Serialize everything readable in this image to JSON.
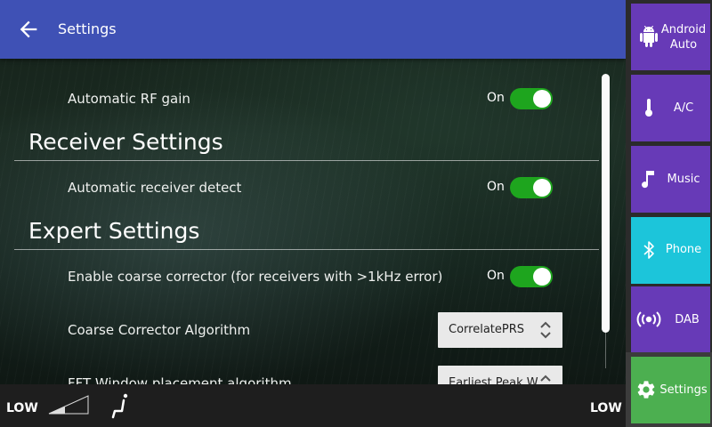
{
  "header": {
    "title": "Settings"
  },
  "settings": {
    "auto_rf_gain": {
      "label": "Automatic RF gain",
      "state": "On"
    },
    "receiver_section": "Receiver Settings",
    "auto_receiver_detect": {
      "label": "Automatic receiver detect",
      "state": "On"
    },
    "expert_section": "Expert Settings",
    "coarse_corrector": {
      "label": "Enable coarse corrector (for receivers with >1kHz error)",
      "state": "On"
    },
    "coarse_algorithm": {
      "label": "Coarse Corrector Algorithm",
      "value": "CorrelatePRS"
    },
    "fft_window": {
      "label": "FFT Window placement algorithm",
      "value": "Earliest Peak W"
    }
  },
  "bottom_bar": {
    "left_level": "LOW",
    "right_level": "LOW"
  },
  "sidebar": {
    "items": [
      {
        "label": "Android Auto",
        "icon": "android-icon",
        "color": "#673ab7"
      },
      {
        "label": "A/C",
        "icon": "thermometer-icon",
        "color": "#673ab7"
      },
      {
        "label": "Music",
        "icon": "music-note-icon",
        "color": "#673ab7"
      },
      {
        "label": "Phone",
        "icon": "bluetooth-icon",
        "color": "#1cc5da"
      },
      {
        "label": "DAB",
        "icon": "broadcast-icon",
        "color": "#673ab7"
      },
      {
        "label": "Settings",
        "icon": "gear-icon",
        "color": "#4caf50"
      }
    ]
  },
  "colors": {
    "header": "#3f51b5",
    "toggle_on": "#1ea51e"
  }
}
